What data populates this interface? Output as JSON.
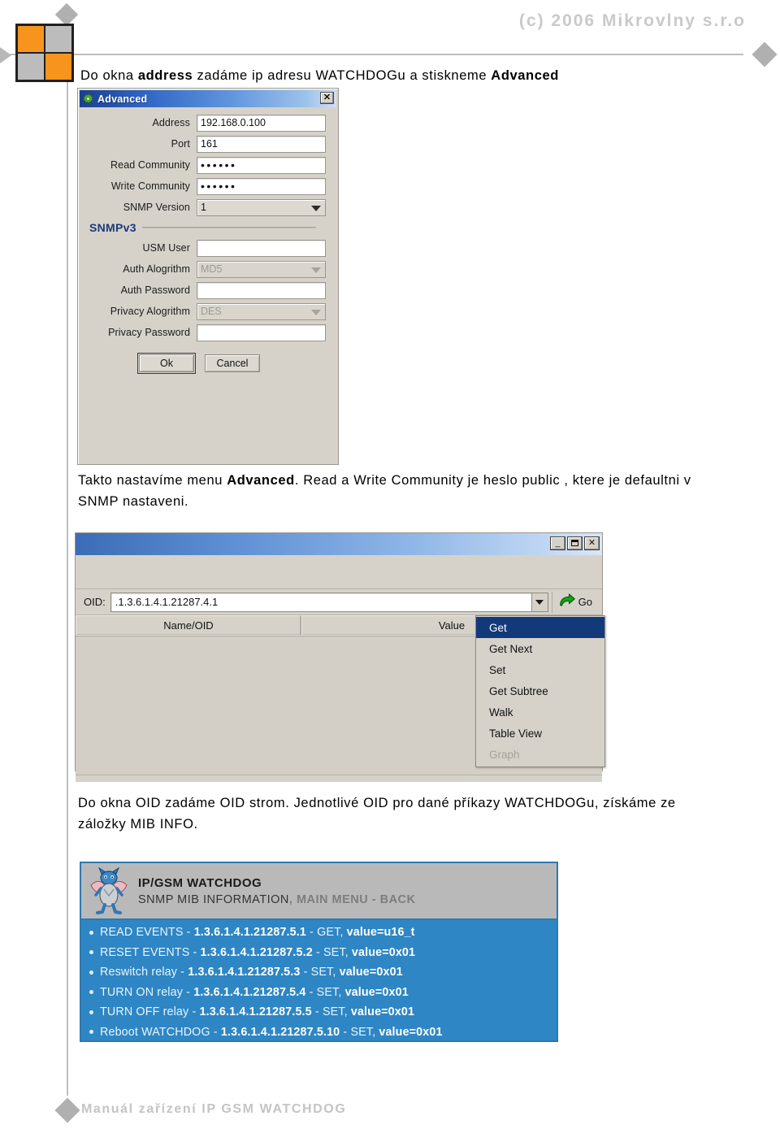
{
  "page": {
    "copyright": "(c) 2006  Mikrovlny s.r.o",
    "footer": "Manuál zařízení IP GSM WATCHDOG",
    "accent_orange": "#f7941e",
    "accent_gray": "#bcbcbc",
    "accent_blue": "#2e86c4"
  },
  "paragraphs": {
    "intro": {
      "part1": "Do okna ",
      "bold1": "address",
      "part2": " zadáme ip adresu WATCHDOGu a stiskneme ",
      "bold2": "Advanced"
    },
    "middle": {
      "part1": "Takto nastavíme menu ",
      "bold1": "Advanced",
      "part2": ". Read a Write Community je heslo public , ktere je defaultni v SNMP nastaveni."
    },
    "oid": {
      "text": "Do okna OID zadáme OID strom.  Jednotlivé OID pro dané příkazy WATCHDOGu, získáme ze záložky MIB INFO."
    }
  },
  "advanced_dialog": {
    "title": "Advanced",
    "close_label": "✕",
    "fields": [
      {
        "label": "Address",
        "value": "192.168.0.100",
        "type": "text"
      },
      {
        "label": "Port",
        "value": "161",
        "type": "text"
      },
      {
        "label": "Read Community",
        "value": "••••••",
        "type": "password"
      },
      {
        "label": "Write Community",
        "value": "••••••",
        "type": "password"
      },
      {
        "label": "SNMP Version",
        "value": "1",
        "type": "combo"
      }
    ],
    "group_title": "SNMPv3",
    "v3_fields": [
      {
        "label": "USM User",
        "value": "",
        "type": "text"
      },
      {
        "label": "Auth Alogrithm",
        "value": "MD5",
        "type": "combo-disabled"
      },
      {
        "label": "Auth Password",
        "value": "",
        "type": "text"
      },
      {
        "label": "Privacy Alogrithm",
        "value": "DES",
        "type": "combo-disabled"
      },
      {
        "label": "Privacy Password",
        "value": "",
        "type": "text"
      }
    ],
    "ok_label": "Ok",
    "cancel_label": "Cancel"
  },
  "mib_browser": {
    "minimize_label": "_",
    "maximize_label": "",
    "close_label": "✕",
    "oid_label": "OID:",
    "oid_value": ".1.3.6.1.4.1.21287.4.1",
    "go_label": "Go",
    "columns": [
      "Name/OID",
      "Value"
    ],
    "menu": [
      {
        "label": "Get",
        "selected": true,
        "disabled": false
      },
      {
        "label": "Get Next",
        "selected": false,
        "disabled": false
      },
      {
        "label": "Set",
        "selected": false,
        "disabled": false
      },
      {
        "label": "Get Subtree",
        "selected": false,
        "disabled": false
      },
      {
        "label": "Walk",
        "selected": false,
        "disabled": false
      },
      {
        "label": "Table View",
        "selected": false,
        "disabled": false
      },
      {
        "label": "Graph",
        "selected": false,
        "disabled": true
      }
    ]
  },
  "watchdog_panel": {
    "title": "IP/GSM WATCHDOG",
    "subtitle_main": "SNMP   MIB INFORMATION",
    "subtitle_dim": ",  MAIN MENU - BACK",
    "items": [
      {
        "name": "READ EVENTS",
        "oid": "1.3.6.1.4.1.21287.5.1",
        "op": "GET,",
        "value": "value=u16_t"
      },
      {
        "name": "RESET EVENTS",
        "oid": "1.3.6.1.4.1.21287.5.2",
        "op": "SET,",
        "value": "value=0x01"
      },
      {
        "name": "Reswitch relay",
        "oid": "1.3.6.1.4.1.21287.5.3",
        "op": "SET,",
        "value": "value=0x01"
      },
      {
        "name": "TURN ON relay",
        "oid": "1.3.6.1.4.1.21287.5.4",
        "op": "SET,",
        "value": "value=0x01"
      },
      {
        "name": "TURN OFF relay",
        "oid": "1.3.6.1.4.1.21287.5.5",
        "op": "SET,",
        "value": "value=0x01"
      },
      {
        "name": "Reboot WATCHDOG",
        "oid": "1.3.6.1.4.1.21287.5.10",
        "op": "SET,",
        "value": "value=0x01"
      }
    ]
  }
}
